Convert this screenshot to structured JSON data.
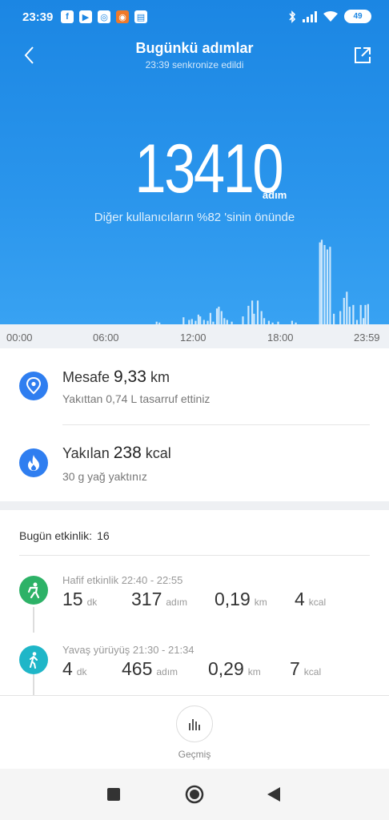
{
  "status_bar": {
    "time": "23:39",
    "apps": [
      "f",
      "▶",
      "◎",
      "◉",
      "▤"
    ],
    "battery": "49"
  },
  "header": {
    "title": "Bugünkü adımlar",
    "sync": "23:39 senkronize edildi"
  },
  "summary": {
    "steps": "13410",
    "unit": "adım",
    "rank": "Diğer kullanıcıların %82 'sinin önünde"
  },
  "chart_data": {
    "type": "bar",
    "x_ticks": [
      "00:00",
      "06:00",
      "12:00",
      "18:00",
      "23:59"
    ],
    "bars_minutes": [
      [
        775,
        3
      ],
      [
        790,
        2
      ],
      [
        920,
        8
      ],
      [
        950,
        5
      ],
      [
        965,
        6
      ],
      [
        985,
        4
      ],
      [
        1000,
        11
      ],
      [
        1010,
        9
      ],
      [
        1030,
        5
      ],
      [
        1050,
        4
      ],
      [
        1065,
        13
      ],
      [
        1080,
        3
      ],
      [
        1100,
        18
      ],
      [
        1110,
        20
      ],
      [
        1125,
        15
      ],
      [
        1140,
        7
      ],
      [
        1155,
        5
      ],
      [
        1180,
        3
      ],
      [
        1240,
        9
      ],
      [
        1270,
        21
      ],
      [
        1290,
        27
      ],
      [
        1300,
        12
      ],
      [
        1320,
        27
      ],
      [
        1340,
        15
      ],
      [
        1355,
        7
      ],
      [
        1380,
        4
      ],
      [
        1400,
        2
      ],
      [
        1430,
        3
      ],
      [
        1505,
        4
      ],
      [
        1525,
        2
      ],
      [
        1655,
        93
      ],
      [
        1665,
        96
      ],
      [
        1680,
        90
      ],
      [
        1695,
        85
      ],
      [
        1710,
        88
      ],
      [
        1730,
        12
      ],
      [
        1765,
        15
      ],
      [
        1785,
        30
      ],
      [
        1800,
        37
      ],
      [
        1815,
        20
      ],
      [
        1835,
        22
      ],
      [
        1855,
        5
      ],
      [
        1875,
        22
      ],
      [
        1890,
        7
      ],
      [
        1900,
        22
      ],
      [
        1915,
        23
      ]
    ],
    "bar_color": "#ffffff"
  },
  "time_axis": [
    "00:00",
    "06:00",
    "12:00",
    "18:00",
    "23:59"
  ],
  "distance": {
    "label": "Mesafe",
    "value": "9,33",
    "unit": "km",
    "sub": "Yakıttan 0,74 L tasarruf ettiniz",
    "icon": "location-pin-icon",
    "color": "#2f7ef0"
  },
  "calories": {
    "label": "Yakılan",
    "value": "238",
    "unit": "kcal",
    "sub": "30 g yağ yaktınız",
    "icon": "flame-icon",
    "color": "#2f7ef0"
  },
  "activity_summary": {
    "label": "Bugün etkinlik:",
    "count": "16"
  },
  "activities": [
    {
      "title": "Hafif etkinlik 22:40 - 22:55",
      "icon": "light-activity-icon",
      "color": "#2db267",
      "duration": "15",
      "duration_unit": "dk",
      "steps": "317",
      "steps_unit": "adım",
      "distance": "0,19",
      "distance_unit": "km",
      "calories": "4",
      "calories_unit": "kcal"
    },
    {
      "title": "Yavaş yürüyüş 21:30 - 21:34",
      "icon": "walking-icon",
      "color": "#1fb6c8",
      "duration": "4",
      "duration_unit": "dk",
      "steps": "465",
      "steps_unit": "adım",
      "distance": "0,29",
      "distance_unit": "km",
      "calories": "7",
      "calories_unit": "kcal"
    }
  ],
  "footer": {
    "history_label": "Geçmiş"
  }
}
